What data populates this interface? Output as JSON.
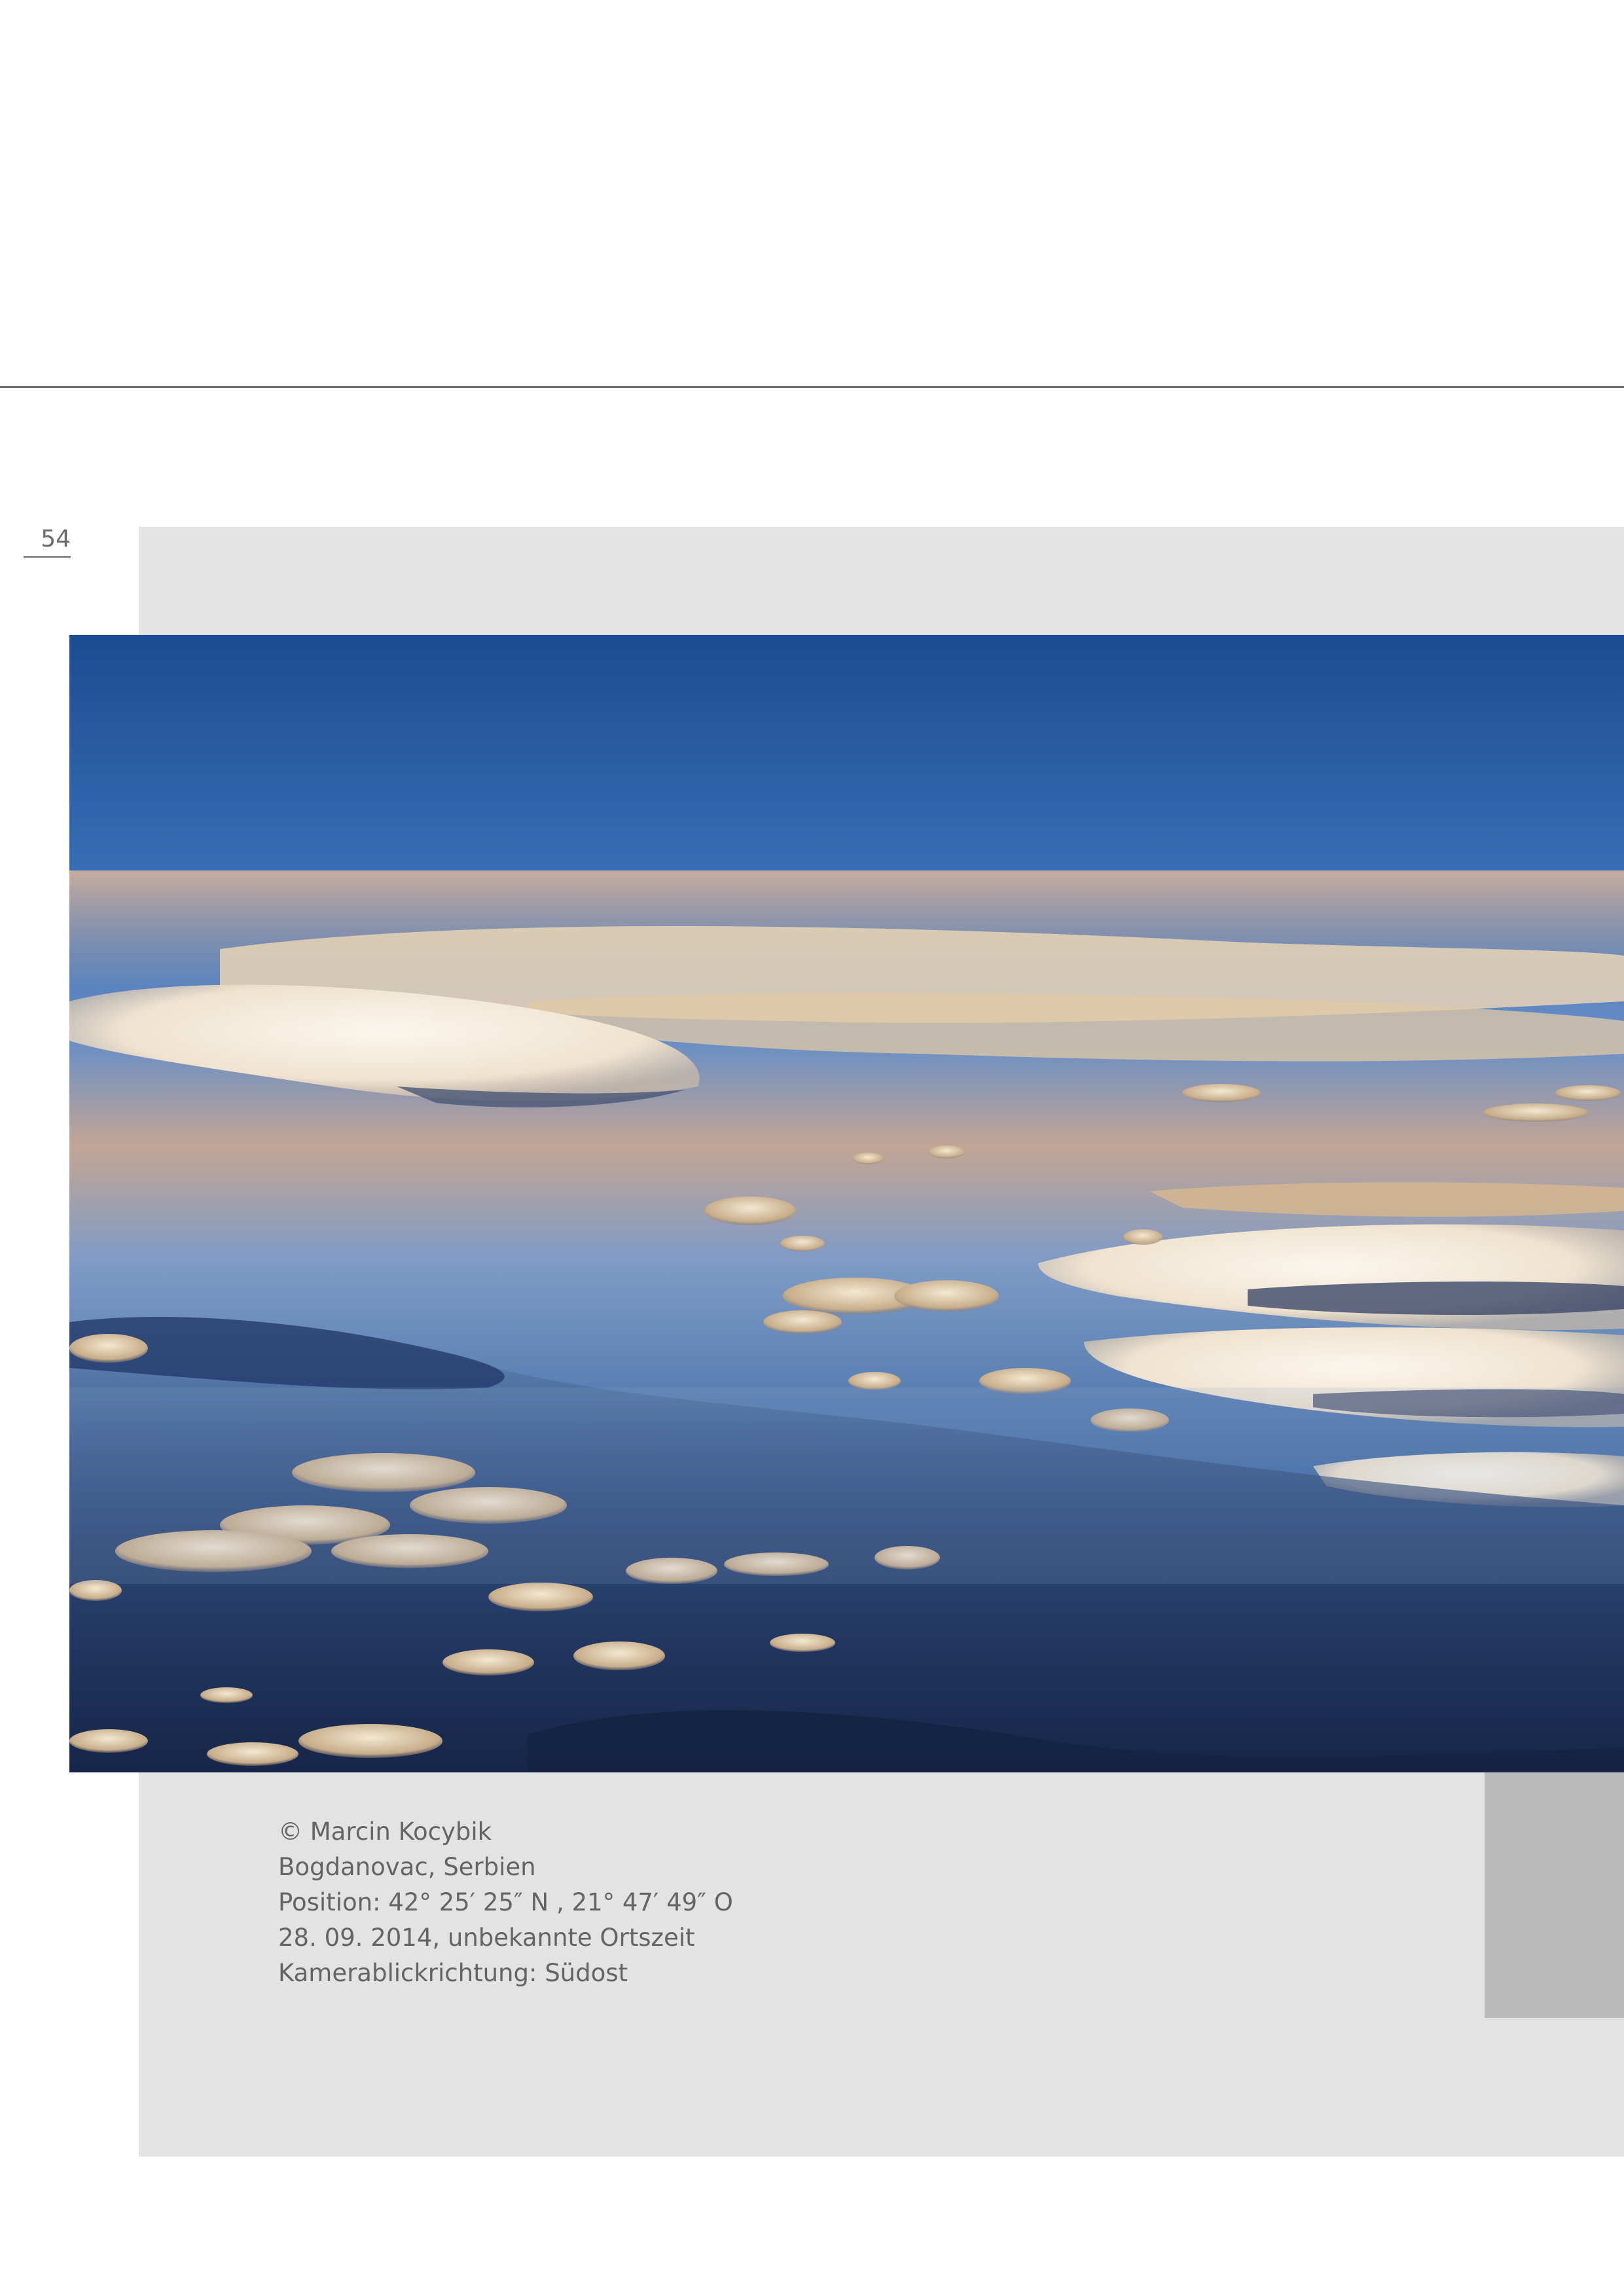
{
  "page": {
    "number": "54"
  },
  "photo": {
    "subject": "aerial-cloud-photo",
    "colors": {
      "sky_top": "#1f4f96",
      "sky_mid": "#4d7fc0",
      "haze": "#c9a98f",
      "cloud": "#f3ecdf",
      "cloud_shadow": "#5f6e8e",
      "land": "#1e2f55"
    }
  },
  "caption": {
    "copyright": "© Marcin Kocybik",
    "location": "Bogdanovac, Serbien",
    "position": "Position: 42° 25′ 25″ N , 21° 47′ 49″ O",
    "date": "28. 09. 2014, unbekannte Ortszeit",
    "direction": "Kamerablickrichtung: Südost"
  }
}
